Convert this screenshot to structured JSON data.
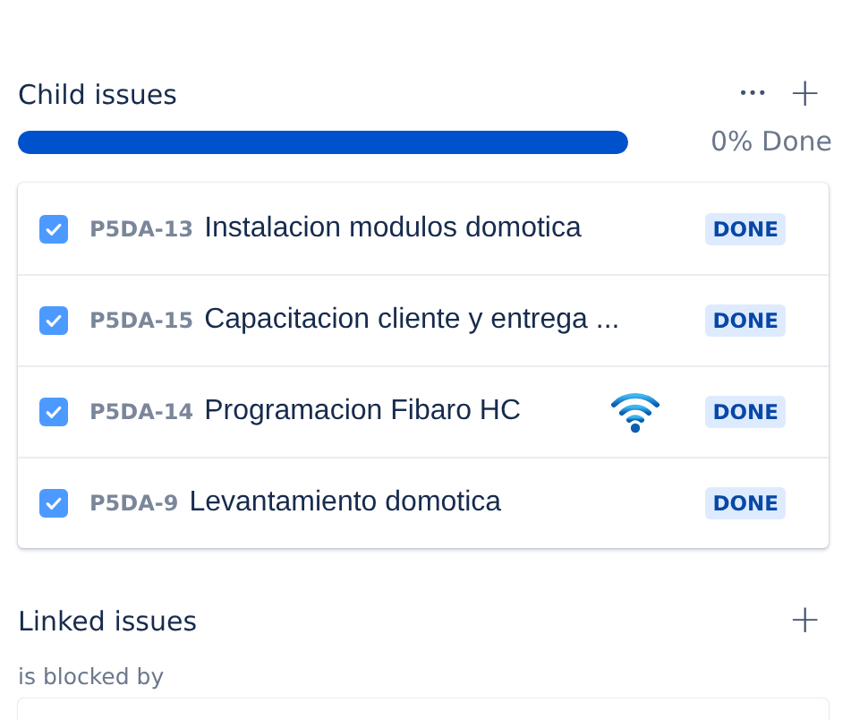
{
  "child_issues": {
    "title": "Child issues",
    "more_label": "•••",
    "add_label": "+",
    "progress": {
      "level": 1,
      "reading": "0% Done"
    },
    "items": [
      {
        "key": "P5DA-13",
        "summary": "Instalacion modulos domotica",
        "checked": true,
        "status": "DONE",
        "wifi_icon": false
      },
      {
        "key": "P5DA-15",
        "summary": "Capacitacion cliente y entrega ...",
        "checked": true,
        "status": "DONE",
        "wifi_icon": false
      },
      {
        "key": "P5DA-14",
        "summary": "Programacion Fibaro HC",
        "checked": true,
        "status": "DONE",
        "wifi_icon": true
      },
      {
        "key": "P5DA-9",
        "summary": "Levantamiento domotica",
        "checked": true,
        "status": "DONE",
        "wifi_icon": false
      }
    ]
  },
  "linked_issues": {
    "title": "Linked issues",
    "add_label": "+",
    "group_label": "is blocked by"
  }
}
